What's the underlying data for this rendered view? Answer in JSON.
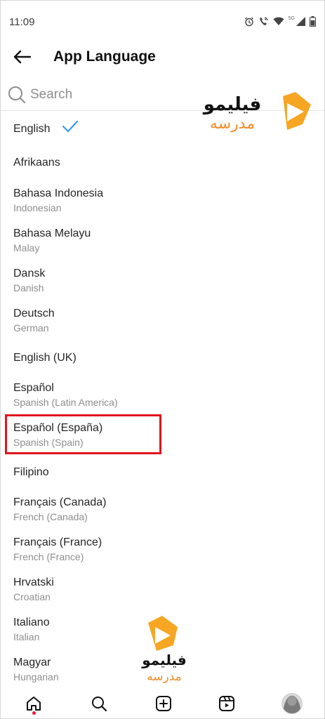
{
  "status_bar": {
    "time": "11:09",
    "network_label": "5G"
  },
  "header": {
    "title": "App Language"
  },
  "search": {
    "placeholder": "Search"
  },
  "watermark": {
    "brand_text": "فیلیمو",
    "sub_text": "مدرسه",
    "brand_color": "#111111",
    "accent_color": "#f28c28"
  },
  "languages": [
    {
      "name": "English",
      "sub": "",
      "selected": true
    },
    {
      "name": "Afrikaans",
      "sub": ""
    },
    {
      "name": "Bahasa Indonesia",
      "sub": "Indonesian"
    },
    {
      "name": "Bahasa Melayu",
      "sub": "Malay"
    },
    {
      "name": "Dansk",
      "sub": "Danish"
    },
    {
      "name": "Deutsch",
      "sub": "German"
    },
    {
      "name": "English (UK)",
      "sub": ""
    },
    {
      "name": "Español",
      "sub": "Spanish (Latin America)"
    },
    {
      "name": "Español (España)",
      "sub": "Spanish (Spain)",
      "highlighted": true
    },
    {
      "name": "Filipino",
      "sub": ""
    },
    {
      "name": "Français (Canada)",
      "sub": "French (Canada)"
    },
    {
      "name": "Français (France)",
      "sub": "French (France)"
    },
    {
      "name": "Hrvatski",
      "sub": "Croatian"
    },
    {
      "name": "Italiano",
      "sub": "Italian"
    },
    {
      "name": "Magyar",
      "sub": "Hungarian"
    }
  ],
  "tab_bar": {
    "tabs": [
      "home-icon",
      "search-icon",
      "create-icon",
      "reels-icon",
      "profile-avatar"
    ],
    "active": "home-icon"
  },
  "colors": {
    "check": "#3897f0",
    "highlight": "#e0161e",
    "notification_dot": "#ed1c35"
  }
}
